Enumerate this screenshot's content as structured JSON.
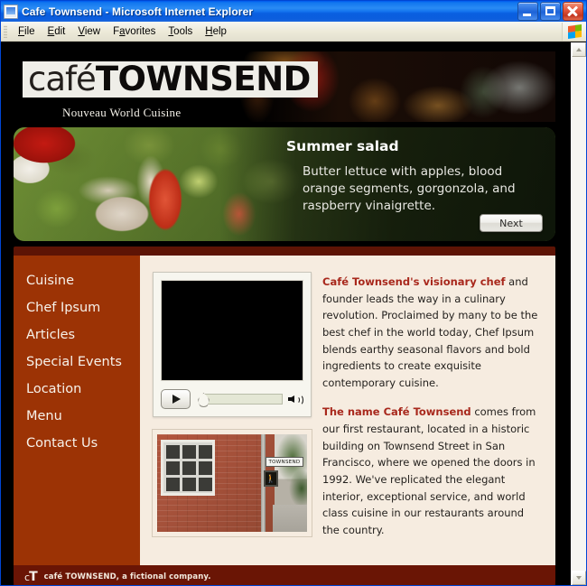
{
  "window": {
    "title": "Cafe Townsend - Microsoft Internet Explorer",
    "icon": "ie-document-icon",
    "minimize_label": "Minimize",
    "maximize_label": "Maximize",
    "close_label": "Close"
  },
  "menubar": {
    "items": [
      {
        "label": "File",
        "accel": "F"
      },
      {
        "label": "Edit",
        "accel": "E"
      },
      {
        "label": "View",
        "accel": "V"
      },
      {
        "label": "Favorites",
        "accel": "a"
      },
      {
        "label": "Tools",
        "accel": "T"
      },
      {
        "label": "Help",
        "accel": "H"
      }
    ]
  },
  "banner": {
    "logo_light": "café",
    "logo_bold": "TOWNSEND",
    "tagline": "Nouveau World Cuisine"
  },
  "hero": {
    "title": "Summer salad",
    "description": "Butter lettuce with apples, blood orange segments, gorgonzola, and raspberry vinaigrette.",
    "next_label": "Next"
  },
  "nav": {
    "items": [
      {
        "label": "Cuisine"
      },
      {
        "label": "Chef Ipsum"
      },
      {
        "label": "Articles"
      },
      {
        "label": "Special Events"
      },
      {
        "label": "Location"
      },
      {
        "label": "Menu"
      },
      {
        "label": "Contact Us"
      }
    ]
  },
  "player": {
    "play_label": "Play",
    "seek_label": "Seek bar",
    "volume_label": "Volume"
  },
  "photo": {
    "street_sign": "TOWNSEND",
    "walk_glyph": "🚶",
    "alt": "Brick corner building at Townsend Street"
  },
  "copy": {
    "p1_lead": "Café Townsend's visionary chef",
    "p1_rest": " and founder leads the way in a culinary revolution. Proclaimed by many to be the best chef in the world today, Chef Ipsum blends earthy seasonal flavors and bold ingredients to create exquisite contemporary cuisine.",
    "p2_lead": "The name Café Townsend",
    "p2_rest": " comes from our first restaurant, located in a historic building on Townsend Street in San Francisco, where we opened the doors in 1992. We've replicated the elegant interior, exceptional service, and world class cuisine in our restaurants around the country."
  },
  "footer": {
    "mark_c": "c",
    "mark_t": "T",
    "text": "café TOWNSEND, a fictional company."
  },
  "colors": {
    "titlebar_blue": "#0b5fd6",
    "nav_orange": "#9c3305",
    "band_dark_red": "#5d1405",
    "footer_red": "#6a1505",
    "content_cream": "#f6ece0",
    "accent_red": "#a8281c"
  }
}
